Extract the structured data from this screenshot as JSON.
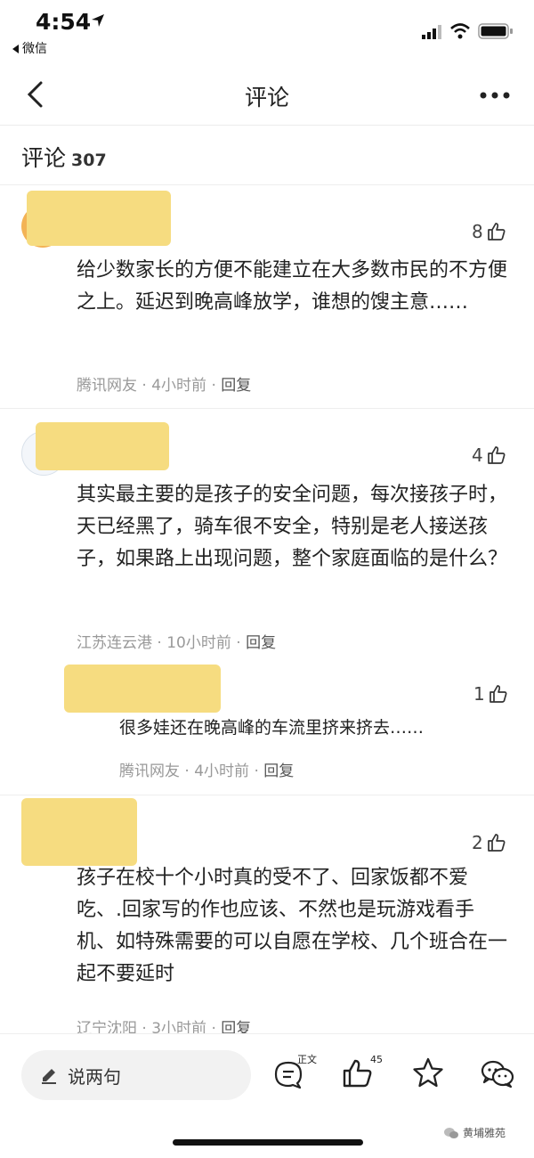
{
  "status_bar": {
    "time": "4:54",
    "back_app": "微信"
  },
  "nav": {
    "title": "评论"
  },
  "comments_header": {
    "title": "评论",
    "count": "307"
  },
  "comments": [
    {
      "likes": "8",
      "text": "给少数家长的方便不能建立在大多数市民的不方便之上。延迟到晚高峰放学，谁想的馊主意……",
      "location": "腾讯网友",
      "time": "4小时前",
      "reply": "回复"
    },
    {
      "likes": "4",
      "text": "其实最主要的是孩子的安全问题，每次接孩子时，天已经黑了，骑车很不安全，特别是老人接送孩子，如果路上出现问题，整个家庭面临的是什么？",
      "location": "江苏连云港",
      "time": "10小时前",
      "reply": "回复"
    },
    {
      "likes": "1",
      "text": "很多娃还在晚高峰的车流里挤来挤去……",
      "location": "腾讯网友",
      "time": "4小时前",
      "reply": "回复"
    },
    {
      "likes": "2",
      "text": "孩子在校十个小时真的受不了、回家饭都不爱吃、.回家写的作也应该、不然也是玩游戏看手机、如特殊需要的可以自愿在学校、几个班合在一起不要延时",
      "location": "辽宁沈阳",
      "time": "3小时前",
      "reply": "回复"
    }
  ],
  "meta_separator": " · ",
  "bottom_bar": {
    "input_label": "说两句",
    "article_label": "正文",
    "like_count": "45",
    "watermark": "黄埔雅苑"
  },
  "colors": {
    "redaction": "#f6dc80",
    "meta_text": "#999999"
  },
  "icons": [
    "location-arrow-icon",
    "signal-icon",
    "wifi-icon",
    "battery-icon",
    "back-chevron-icon",
    "more-icon",
    "thumbs-up-icon",
    "pen-icon",
    "comment-icon",
    "star-icon",
    "share-icon"
  ]
}
